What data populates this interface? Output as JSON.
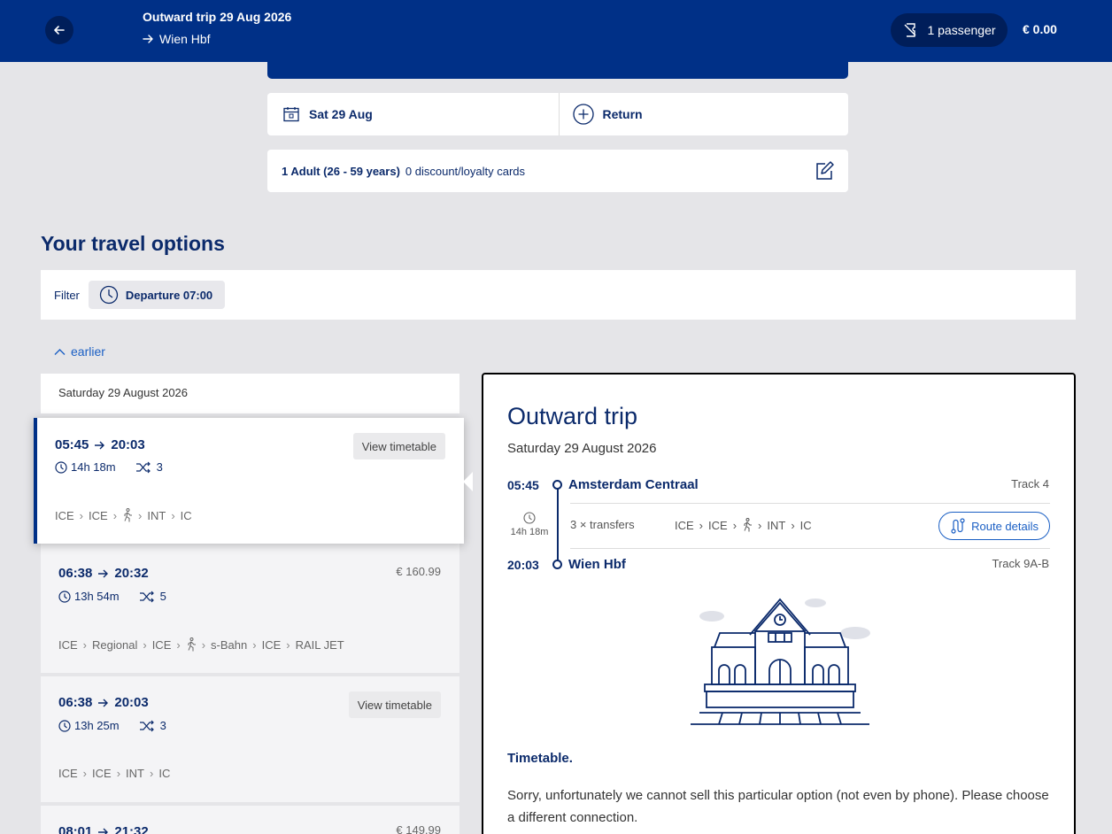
{
  "header": {
    "title": "Outward trip 29 Aug 2026",
    "destination": "Wien Hbf",
    "passenger_label": "1 passenger",
    "total_price": "€ 0.00"
  },
  "search": {
    "date": "Sat 29 Aug",
    "return_label": "Return",
    "passenger_summary_bold": "1 Adult (26 - 59 years)",
    "passenger_summary_rest": "0 discount/loyalty cards"
  },
  "options": {
    "title": "Your travel options",
    "filter_label": "Filter",
    "filter_chip": "Departure 07:00",
    "earlier_label": "earlier",
    "list_date": "Saturday 29 August 2026"
  },
  "trips": [
    {
      "dep": "05:45",
      "arr": "20:03",
      "duration": "14h 18m",
      "transfers": "3",
      "action": "View timetable",
      "legs": [
        "ICE",
        "ICE",
        "walk",
        "INT",
        "IC"
      ]
    },
    {
      "dep": "06:38",
      "arr": "20:32",
      "duration": "13h 54m",
      "transfers": "5",
      "price": "€ 160.99",
      "legs": [
        "ICE",
        "Regional",
        "ICE",
        "walk",
        "s-Bahn",
        "ICE",
        "RAIL JET"
      ]
    },
    {
      "dep": "06:38",
      "arr": "20:03",
      "duration": "13h 25m",
      "transfers": "3",
      "action": "View timetable",
      "legs": [
        "ICE",
        "ICE",
        "INT",
        "IC"
      ]
    },
    {
      "dep": "08:01",
      "arr": "21:32",
      "price": "€ 149.99"
    }
  ],
  "detail": {
    "title": "Outward trip",
    "date": "Saturday 29 August 2026",
    "origin_time": "05:45",
    "origin_name": "Amsterdam Centraal",
    "origin_track": "Track 4",
    "duration": "14h 18m",
    "transfers_text": "3 × transfers",
    "legs": [
      "ICE",
      "ICE",
      "walk",
      "INT",
      "IC"
    ],
    "route_details_label": "Route details",
    "dest_time": "20:03",
    "dest_name": "Wien Hbf",
    "dest_track": "Track 9A-B",
    "timetable_heading": "Timetable.",
    "timetable_text": "Sorry, unfortunately we cannot sell this particular option (not even by phone). Please choose a different connection."
  },
  "colors": {
    "brand": "#003087",
    "link": "#1a5fc4",
    "background": "#e5e5e8"
  }
}
